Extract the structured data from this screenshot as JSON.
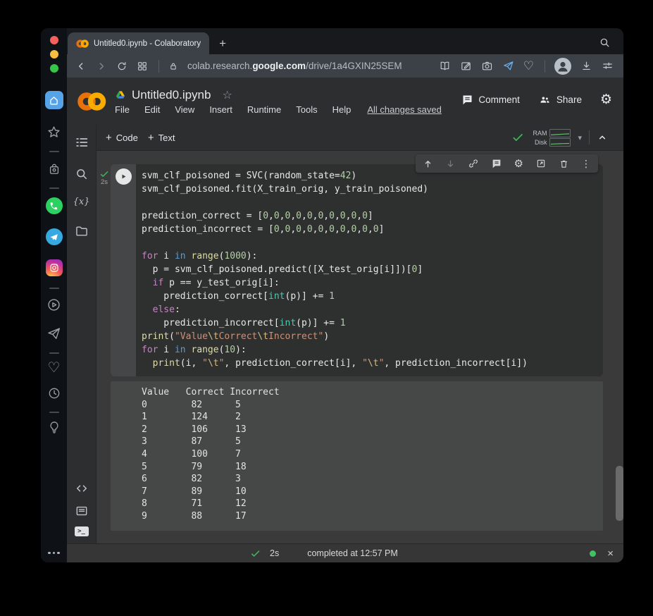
{
  "browser": {
    "tab_title": "Untitled0.ipynb - Colaboratory",
    "url_prefix": "colab.research.",
    "url_domain": "google.com",
    "url_path": "/drive/1a4GXIN25SEM"
  },
  "colab": {
    "doc_title": "Untitled0.ipynb",
    "menus": [
      "File",
      "Edit",
      "View",
      "Insert",
      "Runtime",
      "Tools",
      "Help"
    ],
    "save_status": "All changes saved",
    "comment_label": "Comment",
    "share_label": "Share",
    "toolbar": {
      "code_label": "Code",
      "text_label": "Text"
    },
    "resources": {
      "ram_label": "RAM",
      "disk_label": "Disk"
    }
  },
  "cell": {
    "exec_time": "2s"
  },
  "statusbar": {
    "exec_time": "2s",
    "message": "completed at 12:57 PM"
  },
  "glyphs": {
    "plus": "+",
    "star_outline": "☆",
    "heart_outline": "♡",
    "gear": "⚙",
    "kebab": "⋮",
    "caret_down": "▾",
    "close_x": "×",
    "variables": "{x}",
    "terminal": ">_"
  },
  "colors": {
    "accent_green": "#41b05a",
    "run_ok_green": "#41c363",
    "colab_orange_dark": "#E8710A",
    "colab_orange_light": "#F9AB00",
    "link_blue": "#6cb1ec"
  },
  "code": {
    "lines": [
      [
        [
          "d",
          "svm_clf_poisoned = SVC(random_state="
        ],
        [
          "n",
          "42"
        ],
        [
          "d",
          ")"
        ]
      ],
      [
        [
          "d",
          "svm_clf_poisoned.fit(X_train_orig, y_train_poisoned)"
        ]
      ],
      [],
      [
        [
          "d",
          "prediction_correct = ["
        ],
        [
          "n",
          "0"
        ],
        [
          "d",
          ","
        ],
        [
          "n",
          "0"
        ],
        [
          "d",
          ","
        ],
        [
          "n",
          "0"
        ],
        [
          "d",
          ","
        ],
        [
          "n",
          "0"
        ],
        [
          "d",
          ","
        ],
        [
          "n",
          "0"
        ],
        [
          "d",
          ","
        ],
        [
          "n",
          "0"
        ],
        [
          "d",
          ","
        ],
        [
          "n",
          "0"
        ],
        [
          "d",
          ","
        ],
        [
          "n",
          "0"
        ],
        [
          "d",
          ","
        ],
        [
          "n",
          "0"
        ],
        [
          "d",
          ","
        ],
        [
          "n",
          "0"
        ],
        [
          "d",
          "]"
        ]
      ],
      [
        [
          "d",
          "prediction_incorrect = ["
        ],
        [
          "n",
          "0"
        ],
        [
          "d",
          ","
        ],
        [
          "n",
          "0"
        ],
        [
          "d",
          ","
        ],
        [
          "n",
          "0"
        ],
        [
          "d",
          ","
        ],
        [
          "n",
          "0"
        ],
        [
          "d",
          ","
        ],
        [
          "n",
          "0"
        ],
        [
          "d",
          ","
        ],
        [
          "n",
          "0"
        ],
        [
          "d",
          ","
        ],
        [
          "n",
          "0"
        ],
        [
          "d",
          ","
        ],
        [
          "n",
          "0"
        ],
        [
          "d",
          ","
        ],
        [
          "n",
          "0"
        ],
        [
          "d",
          ","
        ],
        [
          "n",
          "0"
        ],
        [
          "d",
          "]"
        ]
      ],
      [],
      [
        [
          "k",
          "for"
        ],
        [
          "d",
          " i "
        ],
        [
          "b",
          "in"
        ],
        [
          "d",
          " "
        ],
        [
          "f",
          "range"
        ],
        [
          "d",
          "("
        ],
        [
          "n",
          "1000"
        ],
        [
          "d",
          "):"
        ]
      ],
      [
        [
          "d",
          "  p = svm_clf_poisoned.predict([X_test_orig[i]])["
        ],
        [
          "n",
          "0"
        ],
        [
          "d",
          "]"
        ]
      ],
      [
        [
          "d",
          "  "
        ],
        [
          "k",
          "if"
        ],
        [
          "d",
          " p == y_test_orig[i]:"
        ]
      ],
      [
        [
          "d",
          "    prediction_correct["
        ],
        [
          "t",
          "int"
        ],
        [
          "d",
          "(p)] += "
        ],
        [
          "n",
          "1"
        ]
      ],
      [
        [
          "d",
          "  "
        ],
        [
          "k",
          "else"
        ],
        [
          "d",
          ":"
        ]
      ],
      [
        [
          "d",
          "    prediction_incorrect["
        ],
        [
          "t",
          "int"
        ],
        [
          "d",
          "(p)] += "
        ],
        [
          "n",
          "1"
        ]
      ],
      [
        [
          "f",
          "print"
        ],
        [
          "d",
          "("
        ],
        [
          "s",
          "\"Value"
        ],
        [
          "e",
          "\\t"
        ],
        [
          "s",
          "Correct"
        ],
        [
          "e",
          "\\t"
        ],
        [
          "s",
          "Incorrect\""
        ],
        [
          "d",
          ")"
        ]
      ],
      [
        [
          "k",
          "for"
        ],
        [
          "d",
          " i "
        ],
        [
          "b",
          "in"
        ],
        [
          "d",
          " "
        ],
        [
          "f",
          "range"
        ],
        [
          "d",
          "("
        ],
        [
          "n",
          "10"
        ],
        [
          "d",
          "):"
        ]
      ],
      [
        [
          "d",
          "  "
        ],
        [
          "f",
          "print"
        ],
        [
          "d",
          "(i, "
        ],
        [
          "s",
          "\""
        ],
        [
          "e",
          "\\t"
        ],
        [
          "s",
          "\""
        ],
        [
          "d",
          ", prediction_correct[i], "
        ],
        [
          "s",
          "\""
        ],
        [
          "e",
          "\\t"
        ],
        [
          "s",
          "\""
        ],
        [
          "d",
          ", prediction_incorrect[i])"
        ]
      ]
    ]
  },
  "output": {
    "lines": [
      "Value   Correct Incorrect",
      "0        82      5",
      "1        124     2",
      "2        106     13",
      "3        87      5",
      "4        100     7",
      "5        79      18",
      "6        82      3",
      "7        89      10",
      "8        71      12",
      "9        88      17"
    ]
  }
}
